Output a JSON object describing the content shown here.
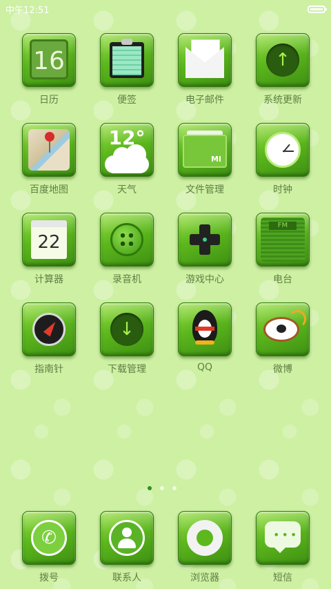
{
  "status_bar": {
    "time": "中午12:51",
    "battery_level": 1.0
  },
  "home_rows": [
    [
      {
        "label": "日历",
        "icon": "calendar-icon",
        "text": "16"
      },
      {
        "label": "便签",
        "icon": "notes-icon"
      },
      {
        "label": "电子邮件",
        "icon": "email-icon"
      },
      {
        "label": "系统更新",
        "icon": "system-update-icon"
      }
    ],
    [
      {
        "label": "百度地图",
        "icon": "map-icon"
      },
      {
        "label": "天气",
        "icon": "weather-icon",
        "text": "12°"
      },
      {
        "label": "文件管理",
        "icon": "file-manager-icon",
        "text": "MI"
      },
      {
        "label": "时钟",
        "icon": "clock-icon"
      }
    ],
    [
      {
        "label": "计算器",
        "icon": "calculator-icon",
        "text": "22"
      },
      {
        "label": "录音机",
        "icon": "recorder-icon"
      },
      {
        "label": "游戏中心",
        "icon": "game-center-icon"
      },
      {
        "label": "电台",
        "icon": "radio-icon",
        "text": "FM"
      }
    ],
    [
      {
        "label": "指南针",
        "icon": "compass-icon"
      },
      {
        "label": "下载管理",
        "icon": "download-manager-icon"
      },
      {
        "label": "QQ",
        "icon": "qq-penguin-icon"
      },
      {
        "label": "微博",
        "icon": "weibo-icon"
      }
    ]
  ],
  "page_indicator": {
    "count": 3,
    "active_index": 0
  },
  "dock": [
    {
      "label": "拨号",
      "icon": "phone-icon"
    },
    {
      "label": "联系人",
      "icon": "contacts-icon"
    },
    {
      "label": "浏览器",
      "icon": "browser-icon"
    },
    {
      "label": "短信",
      "icon": "sms-icon"
    }
  ],
  "colors": {
    "background": "#cdf0a2",
    "tile_green": "#5db81d",
    "label": "#5f7f46"
  }
}
